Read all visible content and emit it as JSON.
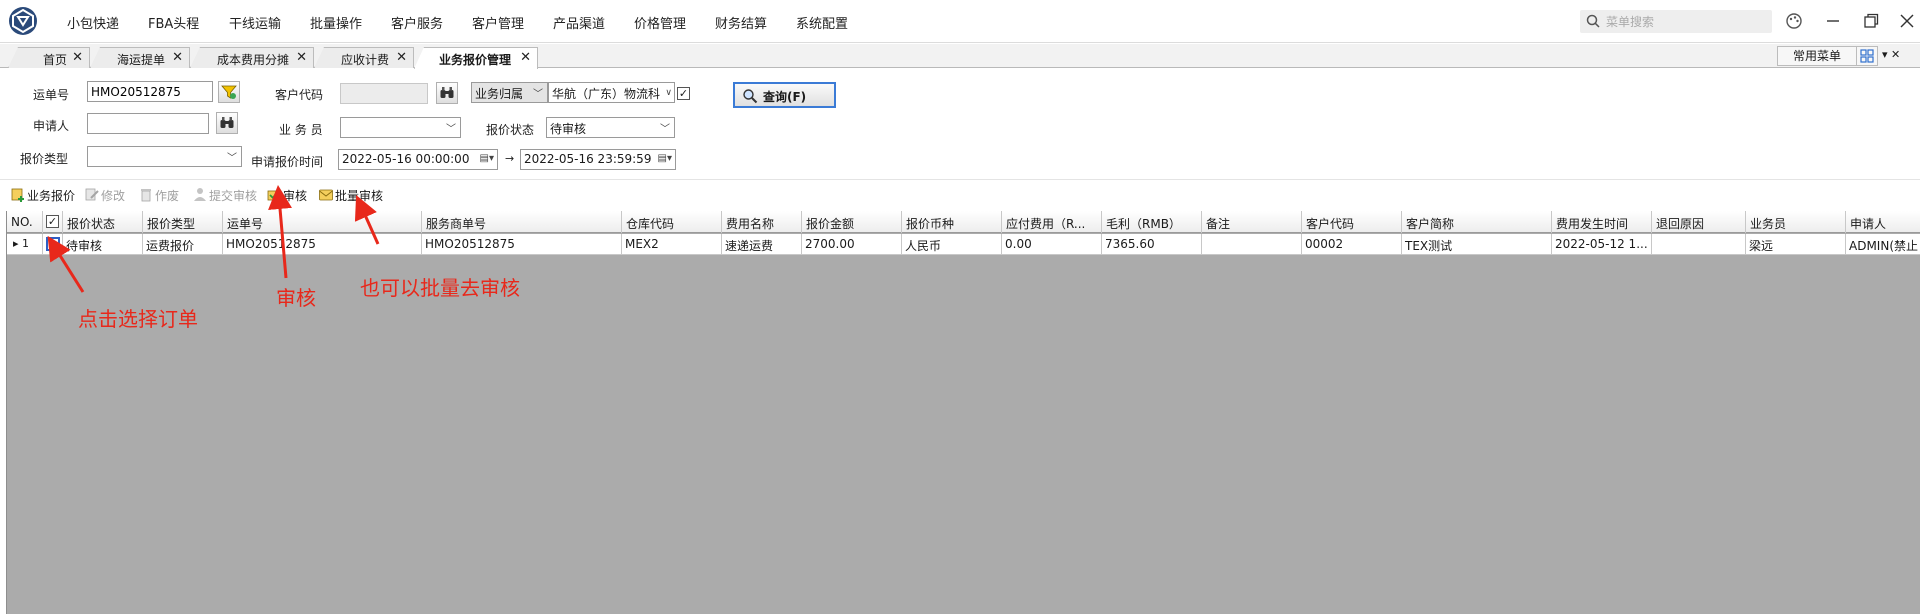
{
  "menu": {
    "items": [
      "小包快递",
      "FBA头程",
      "干线运输",
      "批量操作",
      "客户服务",
      "客户管理",
      "产品渠道",
      "价格管理",
      "财务结算",
      "系统配置"
    ],
    "search_placeholder": "菜单搜索"
  },
  "tabs": {
    "items": [
      "首页",
      "海运提单",
      "成本费用分摊",
      "应收计费",
      "业务报价管理"
    ],
    "close_glyph": "✕",
    "quick_menu": "常用菜单",
    "tools": "▾ ✕"
  },
  "filter": {
    "waybill_label": "运单号",
    "waybill_value": "HMO20512875",
    "customer_code_label": "客户代码",
    "business_owner_combo": "业务归属",
    "business_owner_value": "华航（广东）物流科",
    "query_button": "查询(F)",
    "applicant_label": "申请人",
    "salesperson_label": "业 务 员",
    "status_label": "报价状态",
    "status_value": "待审核",
    "quote_type_label": "报价类型",
    "apply_time_label": "申请报价时间",
    "time_from": "2022-05-16 00:00:00",
    "time_to": "2022-05-16 23:59:59",
    "arrow": "→"
  },
  "toolbar": {
    "business_quote": "业务报价",
    "modify": "修改",
    "void": "作废",
    "submit_audit": "提交审核",
    "audit": "审核",
    "batch_audit": "批量审核"
  },
  "grid": {
    "headers": [
      "NO.",
      "",
      "报价状态",
      "报价类型",
      "运单号",
      "服务商单号",
      "仓库代码",
      "费用名称",
      "报价金额",
      "报价币种",
      "应付费用（R...",
      "毛利（RMB）",
      "备注",
      "客户代码",
      "客户简称",
      "费用发生时间",
      "退回原因",
      "业务员",
      "申请人"
    ],
    "rows": [
      [
        "▸ 1",
        "",
        "待审核",
        "运费报价",
        "HMO20512875",
        "HMO20512875",
        "MEX2",
        "速递运费",
        "2700.00",
        "人民币",
        "0.00",
        "7365.60",
        "",
        "00002",
        "TEX测试",
        "2022-05-12 1...",
        "",
        "梁远",
        "ADMIN(禁止"
      ]
    ]
  },
  "annotations": {
    "select_order": "点击选择订单",
    "audit": "审核",
    "batch_audit": "也可以批量去审核"
  },
  "colors": {
    "annotation": "#e8281b",
    "grid_background": "#ababab",
    "query_border": "#3b7bd6"
  }
}
